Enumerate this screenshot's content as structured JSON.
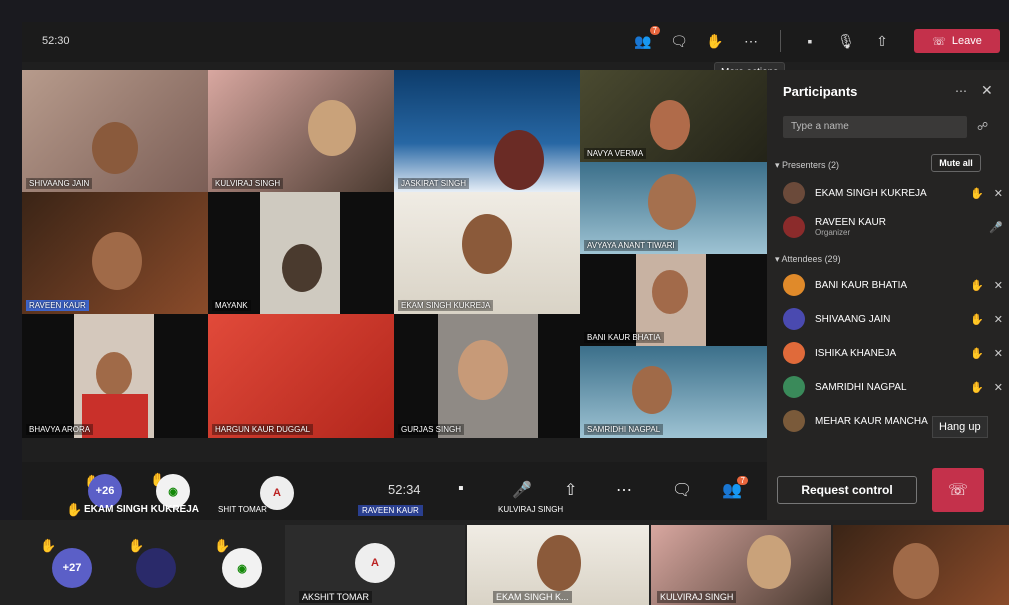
{
  "top": {
    "timer": "52:30",
    "participants_badge": "7",
    "leave_label": "Leave",
    "tooltip": "More actions"
  },
  "tiles": [
    {
      "name": "SHIVAANG JAIN"
    },
    {
      "name": "KULVIRAJ SINGH"
    },
    {
      "name": "JASKIRAT SINGH"
    },
    {
      "name": "NAVYA VERMA"
    },
    {
      "name": "AVYAYA ANANT TIWARI"
    },
    {
      "name": "RAVEEN KAUR"
    },
    {
      "name": "MAYANK"
    },
    {
      "name": "EKAM SINGH KUKREJA"
    },
    {
      "name": "BANI KAUR BHATIA"
    },
    {
      "name": "BHAVYA ARORA"
    },
    {
      "name": "HARGUN KAUR DUGGAL"
    },
    {
      "name": "GURJAS SINGH"
    },
    {
      "name": "SAMRIDHI NAGPAL"
    }
  ],
  "panel": {
    "title": "Participants",
    "search_placeholder": "Type a name",
    "presenters_label": "Presenters (2)",
    "mute_all": "Mute all",
    "attendees_label": "Attendees (29)",
    "presenters": [
      {
        "name": "EKAM SINGH KUKREJA",
        "sub": ""
      },
      {
        "name": "RAVEEN KAUR",
        "sub": "Organizer"
      }
    ],
    "attendees": [
      {
        "name": "BANI KAUR BHATIA"
      },
      {
        "name": "SHIVAANG JAIN"
      },
      {
        "name": "ISHIKA KHANEJA"
      },
      {
        "name": "SAMRIDHI NAGPAL"
      },
      {
        "name": "MEHAR KAUR MANCHA"
      }
    ]
  },
  "controls": {
    "count_badge": "+26",
    "timer": "52:34",
    "participants_badge": "7",
    "request_control": "Request control",
    "hang_up_tip": "Hang up",
    "bottom_names": [
      "EKAM SINGH KUKREJA",
      "SHIT TOMAR",
      "RAVEEN KAUR",
      "KULVIRAJ SINGH"
    ]
  },
  "bottom_strip": {
    "count_badge": "+27",
    "names": [
      "AKSHIT TOMAR",
      "EKAM SINGH K...",
      "KULVIRAJ SINGH"
    ]
  },
  "colors": {
    "leave_red": "#c4314b",
    "badge_orange": "#e8663d",
    "hand_yellow": "#f5b93b"
  }
}
